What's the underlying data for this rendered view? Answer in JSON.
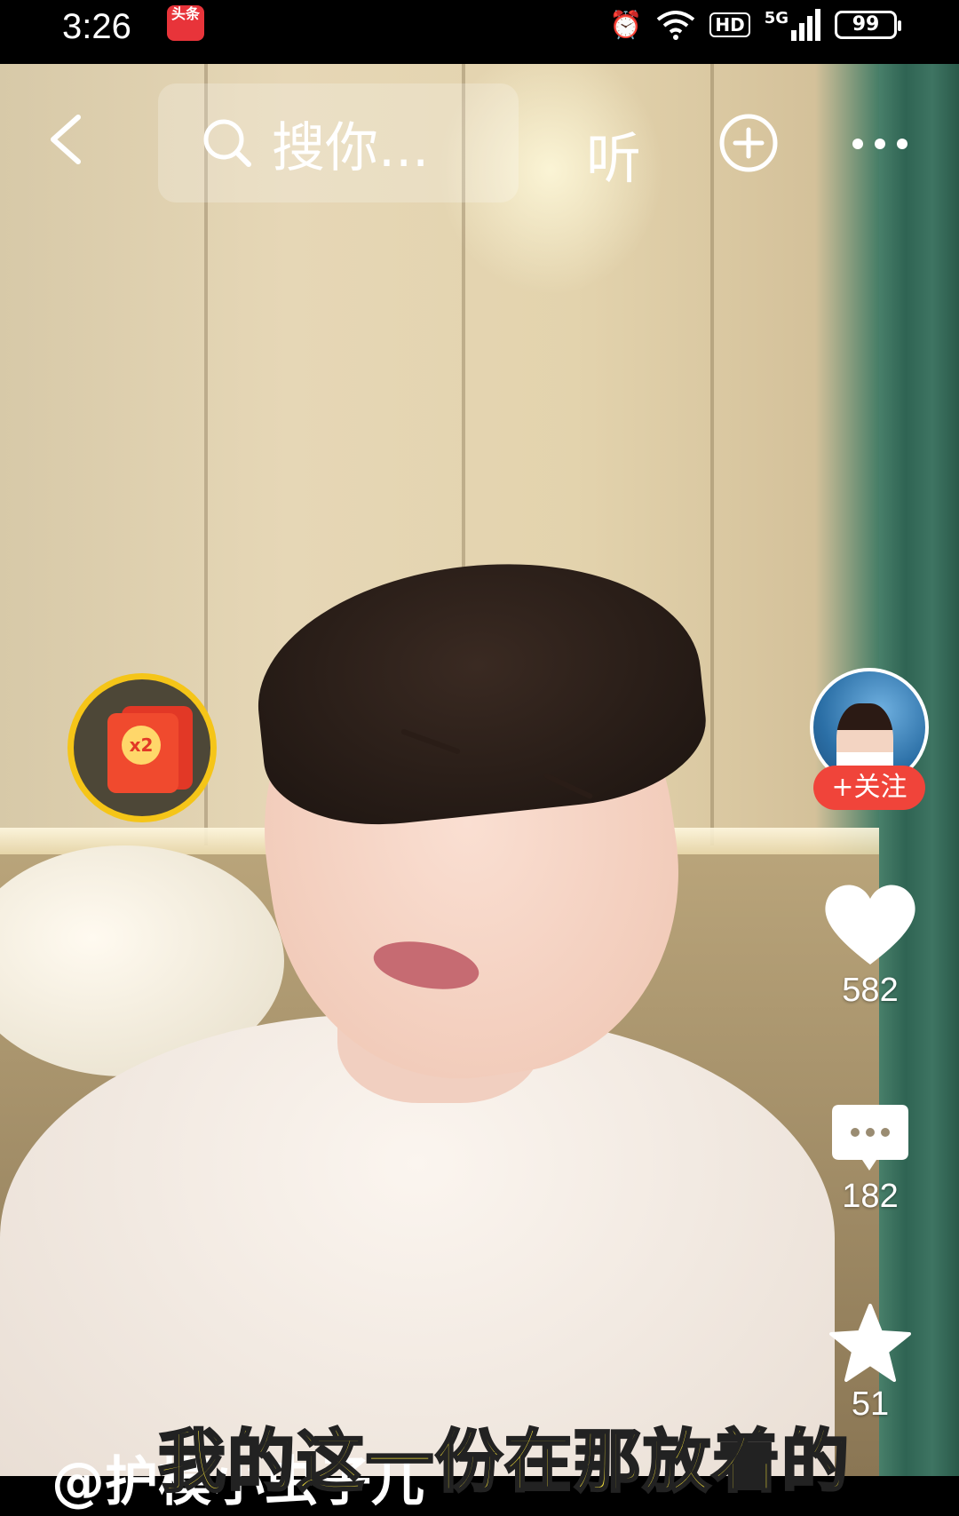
{
  "status_bar": {
    "time": "3:26",
    "app_badge": "头条",
    "network": "5G",
    "hd_label": "HD",
    "battery": "99"
  },
  "top_bar": {
    "search_placeholder": "搜你...",
    "listen_label": "听"
  },
  "sidebar": {
    "follow_label": "+关注",
    "likes_count": "582",
    "comments_count": "182",
    "favorites_count": "51"
  },
  "red_packet": {
    "multiplier": "x2"
  },
  "video": {
    "subtitle": "我的这一份在那放着的",
    "author_handle": "@护模小虫子儿"
  },
  "colors": {
    "follow_red": "#f0443a",
    "subtitle_yellow": "#f6e23a",
    "red_packet_ring": "#f5c518"
  }
}
